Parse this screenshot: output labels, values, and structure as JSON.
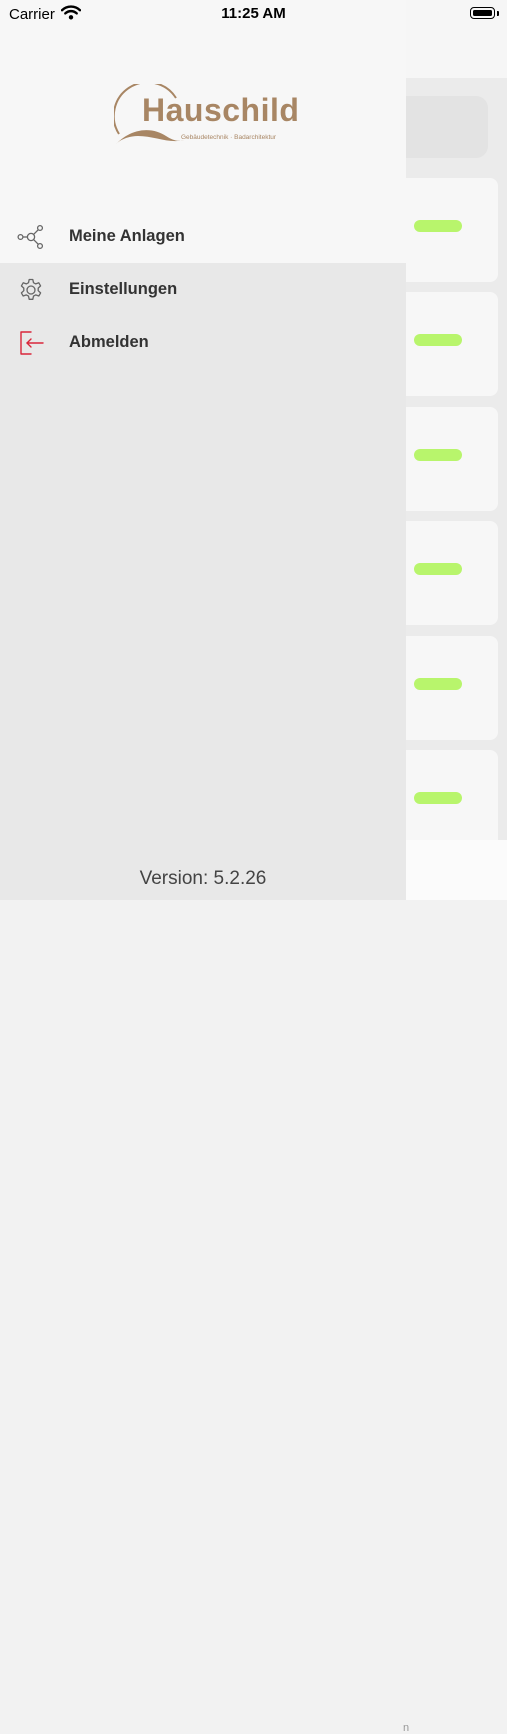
{
  "status_bar": {
    "carrier": "Carrier",
    "time": "11:25 AM"
  },
  "brand": {
    "name": "Hauschild",
    "tagline": "Gebäudetechnik · Badarchitektur",
    "color": "#a88664"
  },
  "menu": {
    "items": [
      {
        "label": "Meine Anlagen",
        "icon": "network-icon"
      },
      {
        "label": "Einstellungen",
        "icon": "gear-icon"
      },
      {
        "label": "Abmelden",
        "icon": "logout-icon",
        "accent": "#d9263a"
      }
    ]
  },
  "footer": {
    "version": "Version: 5.2.26"
  },
  "background": {
    "status_pill_color": "#b8f56c",
    "footer_text": "n"
  }
}
